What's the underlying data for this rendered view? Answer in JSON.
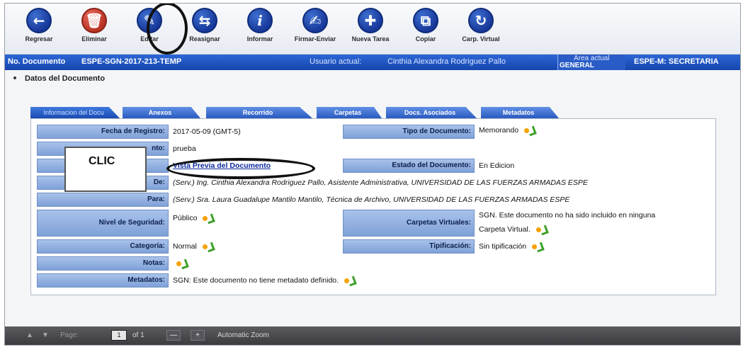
{
  "toolbar": {
    "buttons": [
      {
        "label": "Regresar",
        "icon": "back-arrow-icon",
        "glyph": "←"
      },
      {
        "label": "Eliminar",
        "icon": "trash-icon",
        "glyph": "🗑"
      },
      {
        "label": "Editar",
        "icon": "edit-icon",
        "glyph": "✎"
      },
      {
        "label": "Reasignar",
        "icon": "reassign-icon",
        "glyph": "⇆"
      },
      {
        "label": "Informar",
        "icon": "info-icon",
        "glyph": "i"
      },
      {
        "label": "Firmar-Enviar",
        "icon": "sign-icon",
        "glyph": "✍"
      },
      {
        "label": "Nueva Tarea",
        "icon": "new-task-icon",
        "glyph": "✚"
      },
      {
        "label": "Copiar",
        "icon": "copy-icon",
        "glyph": "⧉"
      },
      {
        "label": "Carp. Virtual",
        "icon": "virtual-folder-icon",
        "glyph": "↻"
      }
    ]
  },
  "infobar": {
    "doc_label": "No. Documento",
    "doc_number": "ESPE-SGN-2017-213-TEMP",
    "user_label": "Usuario actual:",
    "user_name": "Cinthia Alexandra Rodriguez Pallo",
    "area_label": "Area actual",
    "area_sub": "GENERAL",
    "area_value": "ESPE-M: SECRETARIA"
  },
  "section_title": "Datos del Documento",
  "tabs": [
    "Informacion del Docu",
    "Anexos",
    "Recorrido",
    "Carpetas",
    "Docs. Asociados",
    "Metadatos"
  ],
  "form": {
    "fecha_label": "Fecha de Registro:",
    "fecha_value": "2017-05-09 (GMT-5)",
    "tipo_label": "Tipo de Documento:",
    "tipo_value": "Memorando",
    "asunto_label": "nto:",
    "asunto_value": "prueba",
    "preview_link": "Vista Previa del Documento",
    "estado_label": "Estado del Documento:",
    "estado_value": "En Edicion",
    "de_label": "De:",
    "de_value": "(Serv.) Ing. Cinthia Alexandra Rodriguez Pallo, Asistente Administrativa, UNIVERSIDAD DE LAS FUERZAS ARMADAS ESPE",
    "para_label": "Para:",
    "para_value": "(Serv.) Sra. Laura Guadalupe Mantilo Mantilo, Técnica de Archivo, UNIVERSIDAD DE LAS FUERZAS ARMADAS ESPE",
    "nivel_label": "Nivel de Seguridad:",
    "nivel_value": "Público",
    "carpetas_label": "Carpetas Virtuales:",
    "carpetas_value_1": "SGN. Este documento no ha sido incluido en ninguna",
    "carpetas_value_2": "Carpeta Virtual.",
    "categoria_label": "Categoría:",
    "categoria_value": "Normal",
    "tipificacion_label": "Tipificación:",
    "tipificacion_value": "Sin tipificación",
    "notas_label": "Notas:",
    "metadatos_label": "Metadatos:",
    "metadatos_value": "SGN: Este documento no tiene metadato definido."
  },
  "callout": {
    "text": "CLIC"
  },
  "pdfbar": {
    "page_label": "Page:",
    "page_value": "1",
    "of_label": "of 1",
    "zoom_out": "—",
    "zoom_in": "+",
    "zoom_value": "Automatic Zoom"
  }
}
